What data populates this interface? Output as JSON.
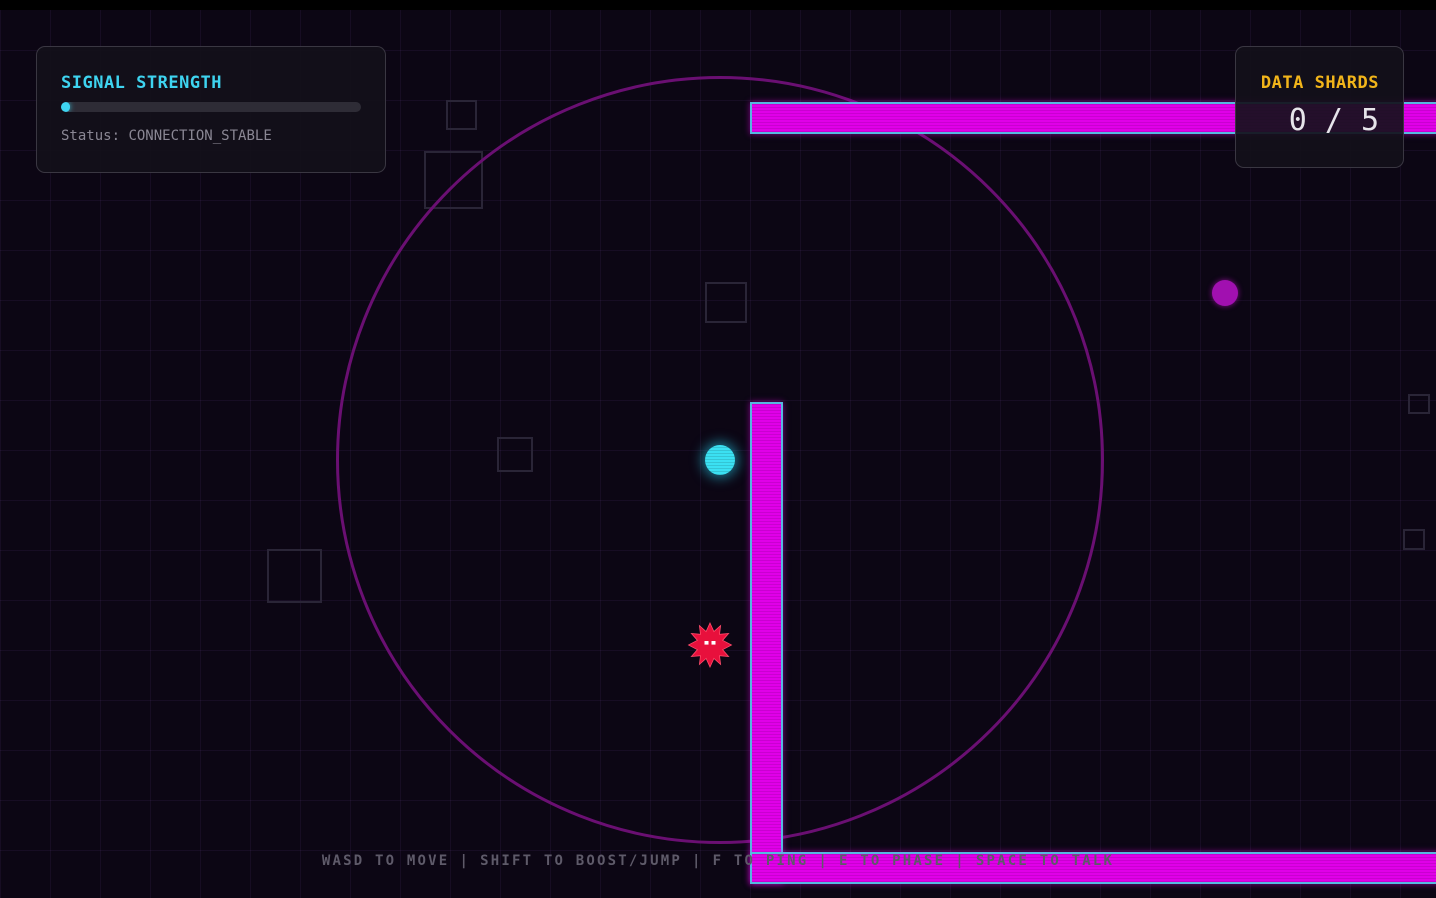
{
  "hud": {
    "signal": {
      "title": "SIGNAL STRENGTH",
      "level": 0.03,
      "status_label": "Status:",
      "status_value": "CONNECTION_STABLE",
      "bar_color": "#3ed4f0"
    },
    "shards": {
      "title": "DATA SHARDS",
      "collected": "0",
      "separator": "/",
      "total": "5",
      "title_color": "#f2b51a"
    }
  },
  "controls": [
    "WASD TO MOVE",
    "SHIFT TO BOOST/JUMP",
    "F TO PING",
    "E TO PHASE",
    "SPACE TO TALK"
  ],
  "controls_separator": "|",
  "colors": {
    "background": "#0c0614",
    "wall_fill": "#e000e8",
    "wall_border": "#57b8e0",
    "player": "#3be0f2",
    "enemy": "#e8103c",
    "shard": "#a110b0",
    "radar_ring": "#6a0f72",
    "obstacle_outline": "#2a2537"
  },
  "entities": {
    "player": "player-orb",
    "enemy": "spiky-virus-icon",
    "pickup": "data-shard-orb"
  }
}
